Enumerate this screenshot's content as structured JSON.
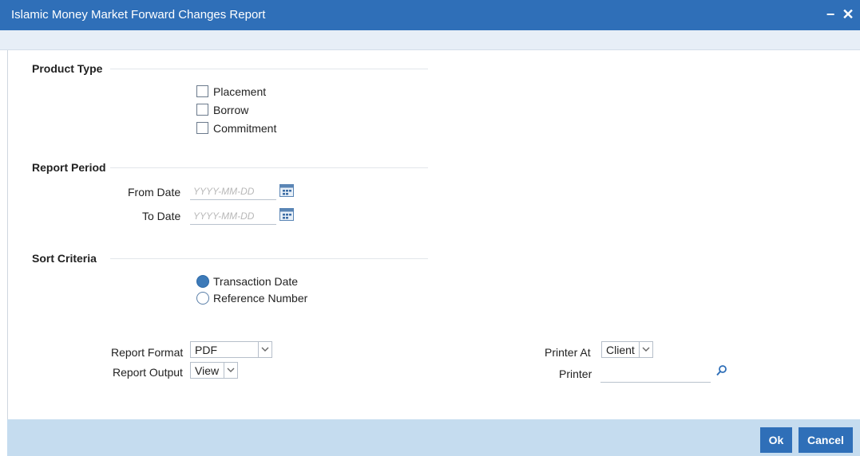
{
  "window": {
    "title": "Islamic Money Market Forward Changes Report",
    "minimize_label": "−",
    "close_label": "✕"
  },
  "product_type": {
    "title": "Product Type",
    "options": [
      {
        "label": "Placement",
        "checked": false
      },
      {
        "label": "Borrow",
        "checked": false
      },
      {
        "label": "Commitment",
        "checked": false
      }
    ]
  },
  "report_period": {
    "title": "Report Period",
    "from_label": "From Date",
    "from_placeholder": "YYYY-MM-DD",
    "to_label": "To Date",
    "to_placeholder": "YYYY-MM-DD"
  },
  "sort_criteria": {
    "title": "Sort Criteria",
    "options": [
      {
        "label": "Transaction Date",
        "selected": true
      },
      {
        "label": "Reference Number",
        "selected": false
      }
    ]
  },
  "report_format": {
    "label": "Report Format",
    "value": "PDF"
  },
  "report_output": {
    "label": "Report Output",
    "value": "View"
  },
  "printer_at": {
    "label": "Printer At",
    "value": "Client"
  },
  "printer": {
    "label": "Printer",
    "value": ""
  },
  "footer": {
    "ok_label": "Ok",
    "cancel_label": "Cancel"
  },
  "colors": {
    "accent": "#2f6fb8",
    "footer_bg": "#c5dcef",
    "radio_selected": "#3d7ab8"
  }
}
